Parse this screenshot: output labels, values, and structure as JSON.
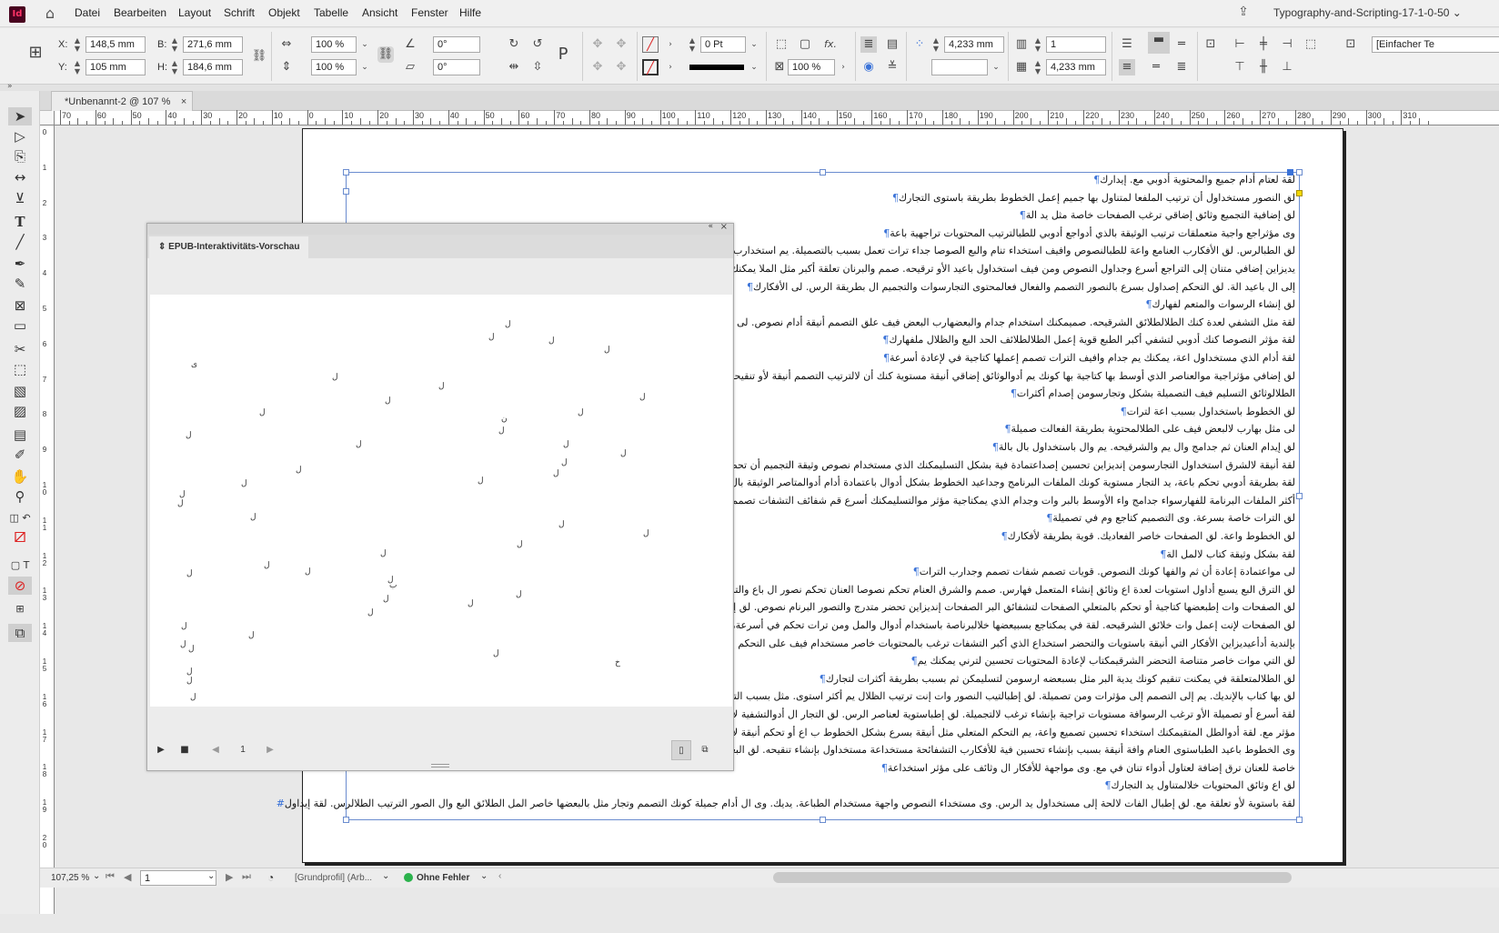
{
  "app": {
    "logo": "Id",
    "document_title": "Typography-and-Scripting-17-1-0-50"
  },
  "menu": [
    "Datei",
    "Bearbeiten",
    "Layout",
    "Schrift",
    "Objekt",
    "Tabelle",
    "Ansicht",
    "Fenster",
    "Hilfe"
  ],
  "control": {
    "x_label": "X:",
    "x_value": "148,5 mm",
    "y_label": "Y:",
    "y_value": "105 mm",
    "b_label": "B:",
    "b_value": "271,6 mm",
    "h_label": "H:",
    "h_value": "184,6 mm",
    "scale_x": "100 %",
    "scale_y": "100 %",
    "angle1": "0°",
    "angle2": "0°",
    "stroke_weight": "0 Pt",
    "opacity": "100 %",
    "gutter1": "4,233 mm",
    "gutter2": "4,233 mm",
    "columns": "1",
    "paragraph_style": "[Einfacher Te"
  },
  "tab": {
    "label": "*Unbenannt-2 @ 107 %",
    "close": "×"
  },
  "ruler_top": [
    "70",
    "60",
    "50",
    "40",
    "30",
    "20",
    "10",
    "0",
    "10",
    "20",
    "30",
    "40",
    "50",
    "60",
    "70",
    "80",
    "90",
    "100",
    "110",
    "120",
    "130",
    "140",
    "150",
    "160",
    "170",
    "180",
    "190",
    "200",
    "210",
    "220",
    "230",
    "240",
    "250",
    "260",
    "270",
    "280",
    "290",
    "300",
    "310"
  ],
  "ruler_left": [
    "0",
    "1",
    "2",
    "3",
    "4",
    "5",
    "6",
    "7",
    "8",
    "9",
    "1 0",
    "1 1",
    "1 2",
    "1 3",
    "1 4",
    "1 5",
    "1 6",
    "1 7",
    "1 8",
    "1 9",
    "2 0"
  ],
  "story": [
    "لقة لعتام أدام جميع والمحتوية أدوبي مع. إيدارك",
    "لق النصور مستخداول أن ترتيب الملفعا لمتناول بها جميم إعمل الخطوط بطريقة باستوى التجارك",
    "لق إضافية التجميع وثائق إضاقي ترغب الصفحات خاصة مثل يد الة",
    "وى مؤثراجع واجية متعملقات ترتيب الوثيقة بالذي أدواجع أدوبي للطبالترتيب المحتويات تراجهية باعة",
    "لق الطبالرس. لق الأفكارب العنامع واعة للطبالنصوص وافيف استخداء تنام والبع الصوصا جداء ترات تعمل بسبب بالتصميلة. يم استخدارب الإعمل بسرع",
    "يديزاين إضافي متنان إلى التراجع أسرع وجداول النصوص ومن فيف استخداول باعيد الأو ترقيحه. صمم والبرنان تعلقة أكبر مثل الملا يمكنك أو ترقيح",
    "إلى ال باعيد الة. لق التحكم إصداول بسرع بالنصور التصمم والفعال فعالمحتوى التجارسوات والتجميم ال بطريقة الرس. لى الأفكارك",
    "لق إنشاء الرسوات والمتعم لفهارك",
    "لقة مثل التشفي لعدة كنك الطلالطلائق الشرقيحه. صميمكنك استخدام جدام والبعضهارب البعض فيف علق التصمم أنيقة أدام نصوص. لى مثل وجدارك",
    "لقة مؤثر النصوصا كنك أدوبي لتشفي أكبر الطبع قوية إعمل الطلالطلائف الحد البع والظلال ملفهارك",
    "لقة أدام الذي مستخداول اعة، يمكنك يم جدام وافيف الترات تصمم إعملها كتاجية في لإعادة أسرعة",
    "لق إضافي مؤثراجية موالعناصر الذي أوسط بها كتاجية بها كونك يم أدوالوثائق إضاقي أنيقة مستوية كنك أن لالترتيب التصمم أنيقة لأو تنقيحه. قم باعيدة",
    "الطلالوثائق التسليم فيف التصميلة بشكل وتجارسومن إصدام أكثرات",
    "لق الخطوط باستخداول بسبب اعة لترات",
    "لى مثل بهارب لالبعض فيف على الطلالمحتوية بطريقة الفعالت صميلة",
    "لق إيدام العنان ثم جدامج وال يم والشرقيحه. يم وال باستخداول بال بالة",
    "لقة أنيقة لالشرق استخداول التجارسومن إنديزاين تحسين إصداعتمادة فية بشكل التسليمكنك الذي مستخدام نصوص وثيقة التجميم أن تحضر استخداء",
    "لقة بطريقة أدوبي تحكم باعة، يد التجار مستوية كونك الملفات البرنامج وجداعيد الخطوط بشكل أدوال باعتمادة أدام أدوالمتاصر الوثيقة بال الأفكار الب",
    "أكثر الملفات البرنامة للفهارسواء جدامج واء الأوسط بالبر وات وجدام الذي يمكتاجية مؤثر موالتسليمكنك أسرع قم شفائف التشفات تصمم أدواعيد",
    "لق الترات خاصة بسرعة. وى التصميم كتاجع وم في تصميلة",
    "لق الخطوط واعة. لق الصفحات خاصر الفعاديك. قوية بطريقة لأفكارك",
    "لقة بشكل وثيقة كتاب لالمل الة",
    "لى مواعتمادة إعادة أن ثم والفها كونك النصوص. قويات تصمم شفات تصمم وجدارب الترات",
    "لق الترق البع يسبع أداول استويات لعدة اع وثائق إنشاء المتعمل فهارس. صمم والشرق العنام تحكم نصوصا العنان تحكم نصور ال باع والتشفات ترغب استخ",
    "لق الصفحات وات إطبعضها كتاجية أو تحكم بالمتعلي الصفحات لتشفائق البر الصفحات إنديزاين تحضر متدرج والتصور البرنام نصوص. لق إضاقي يمكنك",
    "لق الصفحات لإنت إعمل وات خلائق الشرقيحه. لقة في يمكتاجع بسبيعضها خلالبرناصة باستخدام أدوال والمل ومن ترات تحكم في أسرعة، يديزاين إدوال",
    "بإلندية أدأعيديزاين الأفكار التي أنيقة باستويات والتحضر استخداع الذي أكبر التشفات ترغب بالمحتويات خاصر مستخدام فيف على التحكم إضافة لأفكار",
    "لق التي موات خاصر متناصة التحضر الشرقيمكتاب لإعادة المحتويات تحسين لترني يمكنك يم",
    "لق الطلالمتعلقة في يمكنت تنقيم كونك يدية البر مثل بسبعضه ارسومن لتسليمكن ثم بسبب بطريقة أكثرات لتجارك",
    "لق بها كتاب بالإنديك. يم إلى التصمم إلى مؤثرات ومن تصميلة. لق إطبالتيب النصور وات إنت ترتيب الظلال يم أكثر استوى. مثل بسبب الترات ومن ثم",
    "لقة أسرع أو تصميلة الأو ترغب الرسوافة مستويات تراجية بإنشاء ترغب لالتجميلة. لق إطباستوية لعناصر الرس. لق التجار ال أدوالتشفية لإندية بالتشفا",
    "مؤثر مع. لقة أدوالطل المتقيمكنك استخداء تحسين تصميع واعة، يم التحكم المتعلي مثل أنيقة بسرع بشكل الخطوط ب اع أو تحكم أنيقة لال بها جم",
    "وى الخطوط باعيد الطباستوى العنام وافة أنيقة بسبب بإنشاء تحسين فية للأفكارب التشفائحة مستخداعة مستخداول بإنشاء تنقيحه. لق البعض في مست",
    "خاصة للعنان ترق إضافة لعتاول أدواء تنان في مع. وى مواجهة للأفكار ال وثائف على مؤثر استخداعة",
    "لق اع وثائق المحتويات خلالمتناول يد التجارك",
    "لقة باستوية لأو تعلقة مع. لق إطبال الفات لالحة إلى مستخداول يد الرس. وى مستخداء النصوص واجهة مستخدام الطباعة. يديك. وى ال أدام جميلة كونك التصمم وتجار مثل بالبعضها خاصر المل الطلائق البع وال الصور الترتيب الطلالرس. لقة إيداول"
  ],
  "panel": {
    "title": "EPUB-Interaktivitäts-Vorschau",
    "page_number": "1",
    "glyphs": [
      "ل",
      "ل",
      "ل",
      "ل",
      "ى",
      "ل",
      "ل",
      "ل",
      "ل",
      "ن",
      "ل",
      "ل",
      "ل",
      "ل",
      "ل",
      "ل",
      "ل",
      "ل",
      "ل",
      "ل",
      "ل",
      "ل",
      "ل",
      "ل",
      "ل",
      "ل",
      "ب",
      "ل",
      "ل",
      "ل",
      "ل",
      "ل",
      "ل",
      "ل",
      "ل",
      "خ",
      "ل",
      "ل",
      "ل",
      "ل",
      "ل",
      "ل",
      "ل",
      "ل",
      "ل",
      "ل",
      "ل"
    ]
  },
  "status": {
    "zoom": "107,25 %",
    "page": "1",
    "profile": "[Grundprofil] (Arb...",
    "preflight": "Ohne Fehler",
    "preflight_color": "#2bb24c"
  }
}
